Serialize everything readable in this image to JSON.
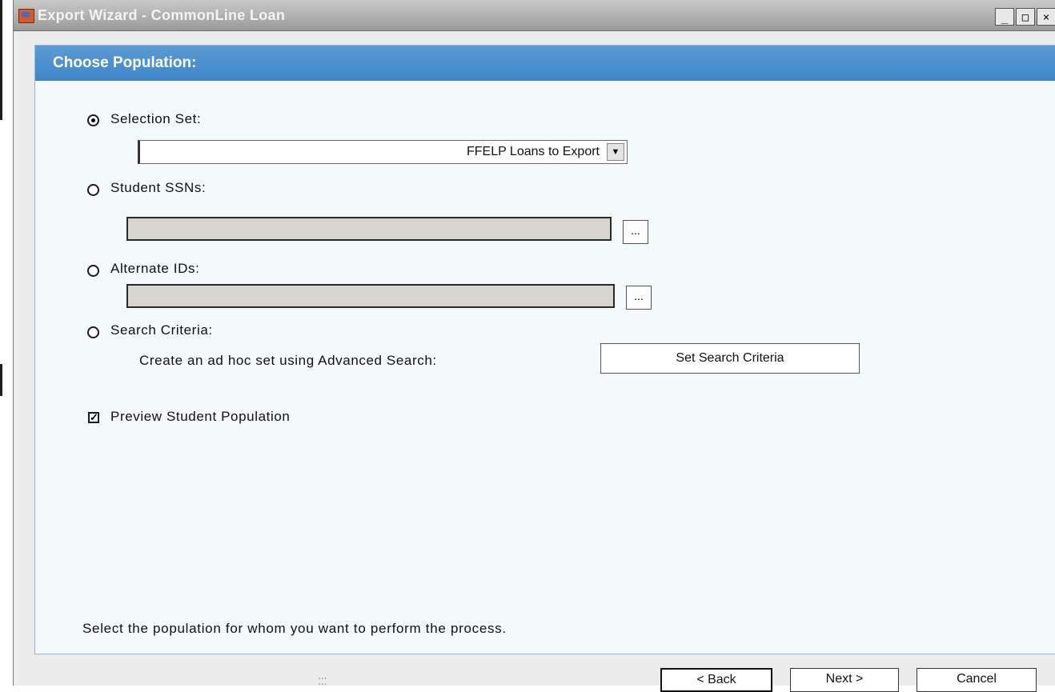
{
  "window": {
    "title": "Export Wizard - CommonLine Loan",
    "controls": {
      "minimize": "_",
      "maximize": "□",
      "close": "×"
    }
  },
  "page": {
    "heading": "Choose Population:"
  },
  "population": {
    "selection_set": {
      "label": "Selection Set:",
      "selected": true,
      "value": "FFELP Loans to Export"
    },
    "student_ssns": {
      "label": "Student SSNs:",
      "selected": false,
      "value": "",
      "browse_label": "..."
    },
    "alternate_ids": {
      "label": "Alternate IDs:",
      "selected": false,
      "value": "",
      "browse_label": "..."
    },
    "search_criteria": {
      "label": "Search Criteria:",
      "selected": false,
      "description": "Create an ad hoc set using Advanced Search:",
      "button_label": "Set Search Criteria"
    },
    "preview": {
      "label": "Preview Student Population",
      "checked": true
    }
  },
  "instructions": "Select the population for whom you want to perform the process.",
  "nav": {
    "back_label": "< Back",
    "next_label": "Next >",
    "cancel_label": "Cancel"
  },
  "colors": {
    "header_band": "#4a8fd0",
    "panel_bg": "#f4f9fc",
    "titlebar": "#a8a8a8"
  }
}
